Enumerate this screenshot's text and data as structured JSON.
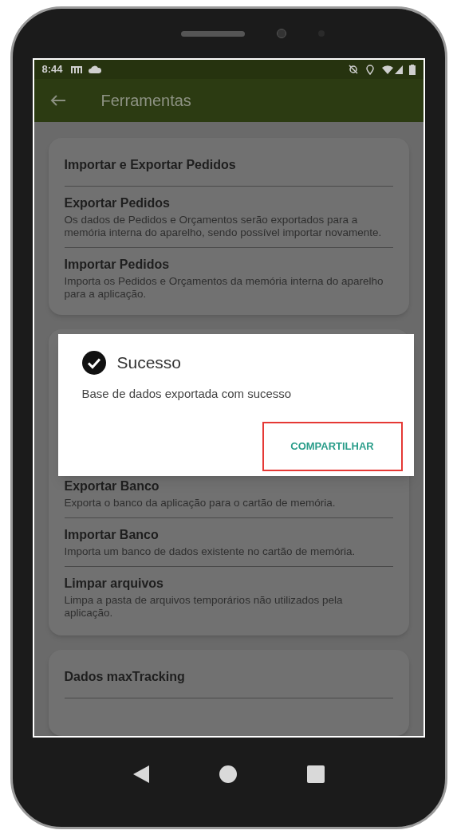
{
  "status_bar": {
    "time": "8:44"
  },
  "app_bar": {
    "title": "Ferramentas"
  },
  "cards": [
    {
      "title": "Importar e Exportar Pedidos",
      "items": [
        {
          "title": "Exportar Pedidos",
          "description": "Os dados de Pedidos e Orçamentos serão exportados para a memória interna do aparelho, sendo possível importar novamente."
        },
        {
          "title": "Importar Pedidos",
          "description": "Importa os Pedidos e Orçamentos da memória interna do aparelho para a aplicação."
        }
      ]
    },
    {
      "items": [
        {
          "title": "Exportar Banco",
          "description": "Exporta o banco da aplicação para o cartão de memória."
        },
        {
          "title": "Importar Banco",
          "description": "Importa um banco de dados existente no cartão de memória."
        },
        {
          "title": "Limpar arquivos",
          "description": "Limpa a pasta de arquivos temporários não utilizados pela aplicação."
        }
      ]
    },
    {
      "title": "Dados maxTracking"
    }
  ],
  "dialog": {
    "title": "Sucesso",
    "message": "Base de dados exportada com sucesso",
    "button": {
      "label": "COMPARTILHAR",
      "highlighted": true
    }
  }
}
